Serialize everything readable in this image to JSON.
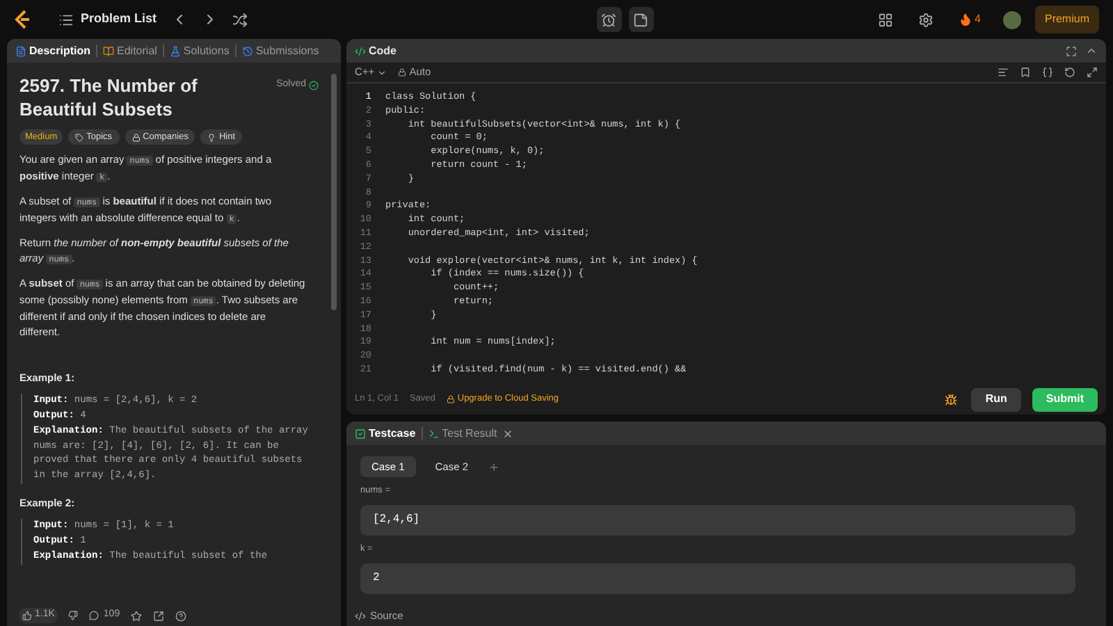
{
  "top_bar": {
    "problem_list": "Problem List",
    "streak": "4",
    "premium": "Premium"
  },
  "left_tabs": [
    {
      "label": "Description",
      "selected": true,
      "kind": "description"
    },
    {
      "label": "Editorial",
      "selected": false,
      "kind": "editorial"
    },
    {
      "label": "Solutions",
      "selected": false,
      "kind": "solutions"
    },
    {
      "label": "Submissions",
      "selected": false,
      "kind": "submissions"
    }
  ],
  "problem": {
    "title": "2597. The Number of Beautiful Subsets",
    "status": "Solved",
    "difficulty": "Medium",
    "tags": [
      {
        "label": "Topics",
        "kind": "topics"
      },
      {
        "label": "Companies",
        "kind": "companies"
      },
      {
        "label": "Hint",
        "kind": "hint"
      }
    ],
    "paragraphs": [
      [
        {
          "kind": "text",
          "text": "You are given an array "
        },
        {
          "kind": "code",
          "text": "nums"
        },
        {
          "kind": "text",
          "text": " of positive integers and a **positive** integer "
        },
        {
          "kind": "code",
          "text": "k"
        },
        {
          "kind": "text",
          "text": "."
        }
      ],
      [
        {
          "kind": "text",
          "text": "A subset of "
        },
        {
          "kind": "code",
          "text": "nums"
        },
        {
          "kind": "text",
          "text": " is **beautiful** if it does not contain two integers with an absolute difference equal to "
        },
        {
          "kind": "code",
          "text": "k"
        },
        {
          "kind": "text",
          "text": "."
        }
      ],
      [
        {
          "kind": "text",
          "text": "Return "
        },
        {
          "kind": "italic",
          "text": "the number of **non-empty beautiful** subsets of the array "
        },
        {
          "kind": "code",
          "text": "nums"
        },
        {
          "kind": "text",
          "text": "."
        }
      ],
      [
        {
          "kind": "text",
          "text": "A **subset** of "
        },
        {
          "kind": "code",
          "text": "nums"
        },
        {
          "kind": "text",
          "text": " is an array that can be obtained by deleting some (possibly none) elements from "
        },
        {
          "kind": "code",
          "text": "nums"
        },
        {
          "kind": "text",
          "text": ". Two subsets are different if and only if the chosen indices to delete are different."
        }
      ]
    ],
    "examples": [
      {
        "title": "Example 1:",
        "lines": [
          {
            "label": "Input:",
            "text": "nums = [2,4,6], k = 2"
          },
          {
            "label": "Output:",
            "text": "4"
          },
          {
            "label": "Explanation:",
            "text": "The beautiful subsets of the array nums are: [2], [4], [6], [2, 6]. It can be proved that there are only 4 beautiful subsets in the array [2,4,6]."
          }
        ]
      },
      {
        "title": "Example 2:",
        "lines": [
          {
            "label": "Input:",
            "text": "nums = [1], k = 1"
          },
          {
            "label": "Output:",
            "text": "1"
          },
          {
            "label": "Explanation:",
            "text": "The beautiful subset of the"
          }
        ]
      }
    ]
  },
  "left_footer": {
    "likes": "1.1K",
    "comments": "109"
  },
  "code_panel": {
    "tab": "Code",
    "language": "C++",
    "mode": "Auto",
    "lines": [
      {
        "number": "1",
        "text": "class Solution {"
      },
      {
        "number": "2",
        "text": "public:"
      },
      {
        "number": "3",
        "text": "    int beautifulSubsets(vector<int>& nums, int k) {"
      },
      {
        "number": "4",
        "text": "        count = 0;"
      },
      {
        "number": "5",
        "text": "        explore(nums, k, 0);"
      },
      {
        "number": "6",
        "text": "        return count - 1;"
      },
      {
        "number": "7",
        "text": "    }"
      },
      {
        "number": "8"
      },
      {
        "number": "9",
        "text": "private:"
      },
      {
        "number": "10",
        "text": "    int count;"
      },
      {
        "number": "11",
        "text": "    unordered_map<int, int> visited;"
      },
      {
        "number": "12"
      },
      {
        "number": "13",
        "text": "    void explore(vector<int>& nums, int k, int index) {"
      },
      {
        "number": "14",
        "text": "        if (index == nums.size()) {"
      },
      {
        "number": "15",
        "text": "            count++;"
      },
      {
        "number": "16",
        "text": "            return;"
      },
      {
        "number": "17",
        "text": "        }"
      },
      {
        "number": "18"
      },
      {
        "number": "19",
        "text": "        int num = nums[index];"
      },
      {
        "number": "20"
      },
      {
        "number": "21",
        "text": "        if (visited.find(num - k) == visited.end() &&"
      }
    ],
    "status": {
      "position": "Ln 1, Col 1",
      "saved": "Saved",
      "upgrade": "Upgrade to Cloud Saving"
    },
    "run": "Run",
    "submit": "Submit"
  },
  "bottom_tabs": [
    {
      "label": "Testcase",
      "selected": true,
      "kind": "testcase"
    },
    {
      "label": "Test Result",
      "selected": false,
      "kind": "result"
    }
  ],
  "cases": [
    {
      "label": "Case 1",
      "selected": true
    },
    {
      "label": "Case 2",
      "selected": false
    }
  ],
  "params": [
    {
      "name": "nums =",
      "value": "[2,4,6]"
    },
    {
      "name": "k =",
      "value": "2"
    }
  ],
  "source": "Source"
}
